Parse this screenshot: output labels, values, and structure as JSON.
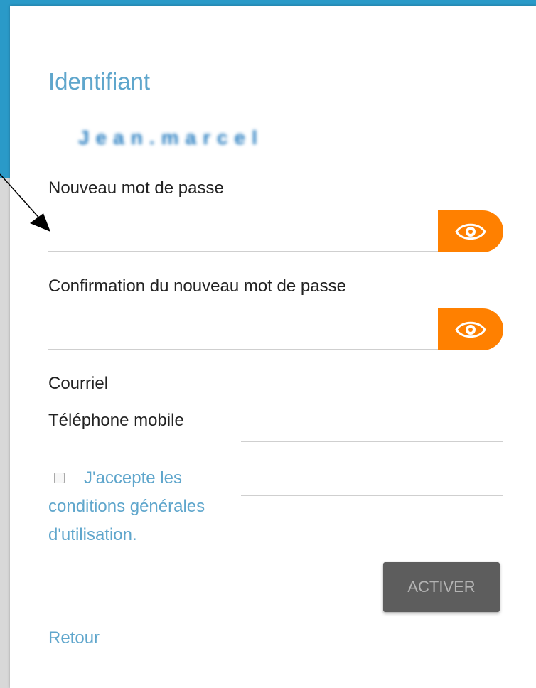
{
  "form": {
    "identifiant_label": "Identifiant",
    "identifiant_value": "Jean.marcel",
    "new_password_label": "Nouveau mot de passe",
    "confirm_password_label": "Confirmation du nouveau mot de passe",
    "email_label": "Courriel",
    "mobile_label": "Téléphone mobile",
    "terms_link": "J'accepte les conditions générales d'utilisation.",
    "terms_checked": false,
    "activate_button": "ACTIVER",
    "back_link": "Retour"
  },
  "icons": {
    "show_password": "eye-icon",
    "annotation": "arrow-pointer"
  },
  "colors": {
    "header_blue": "#2a9ac8",
    "accent_orange": "#ff8000",
    "link_blue": "#5fa6cc",
    "button_grey": "#5d5d5d"
  }
}
